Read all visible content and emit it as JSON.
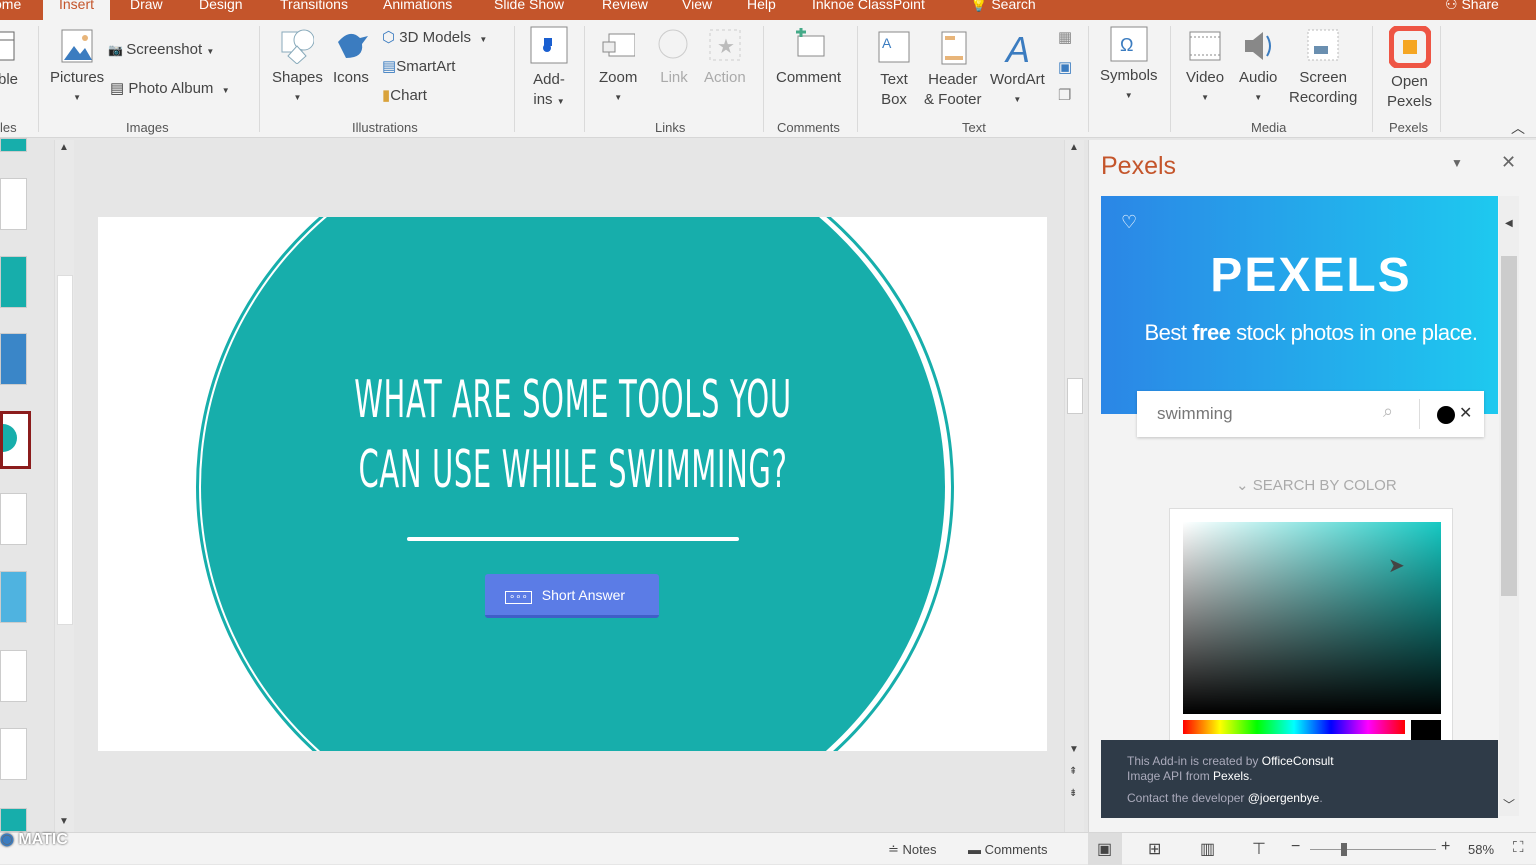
{
  "tabs": [
    "ome",
    "Insert",
    "Draw",
    "Design",
    "Transitions",
    "Animations",
    "Slide Show",
    "Review",
    "View",
    "Help",
    "Inknoe ClassPoint",
    "Search",
    "Share"
  ],
  "ribbon": {
    "table": "ble",
    "table_group": "les",
    "pictures": "Pictures",
    "screenshot": "Screenshot",
    "photo_album": "Photo Album",
    "images_group": "Images",
    "shapes": "Shapes",
    "icons": "Icons",
    "models": "3D Models",
    "smartart": "SmartArt",
    "chart": "Chart",
    "illustrations_group": "Illustrations",
    "addins1": "Add-",
    "addins2": "ins",
    "zoom": "Zoom",
    "link": "Link",
    "action": "Action",
    "links_group": "Links",
    "comment": "Comment",
    "comments_group": "Comments",
    "textbox1": "Text",
    "textbox2": "Box",
    "header1": "Header",
    "header2": "& Footer",
    "wordart": "WordArt",
    "text_group": "Text",
    "symbols": "Symbols",
    "video": "Video",
    "audio": "Audio",
    "screen1": "Screen",
    "screen2": "Recording",
    "media_group": "Media",
    "open1": "Open",
    "open2": "Pexels",
    "pexels_group": "Pexels"
  },
  "slide": {
    "title_line1": "WHAT ARE SOME TOOLS YOU",
    "title_line2": "CAN USE WHILE SWIMMING?",
    "button": "Short Answer"
  },
  "pexels": {
    "pane_title": "Pexels",
    "logo": "PEXELS",
    "tagline_pre": "Best ",
    "tagline_bold": "free",
    "tagline_post": " stock photos in one place.",
    "search_value": "swimming",
    "search_by_color": "SEARCH BY COLOR",
    "footer_line1_pre": "This Add-in is created by ",
    "footer_line1_b": "OfficeConsult",
    "footer_line2_pre": "Image API from ",
    "footer_line2_b": "Pexels",
    "footer_line3_pre": "Contact the developer ",
    "footer_line3_b": "@joergenbye",
    "accent": "#2b86e6"
  },
  "status": {
    "notes": "Notes",
    "comments": "Comments",
    "zoom": "58%",
    "watermark": "MATIC"
  },
  "colors": {
    "tab_bar": "#c4552b",
    "slide_teal": "#17aeab"
  }
}
